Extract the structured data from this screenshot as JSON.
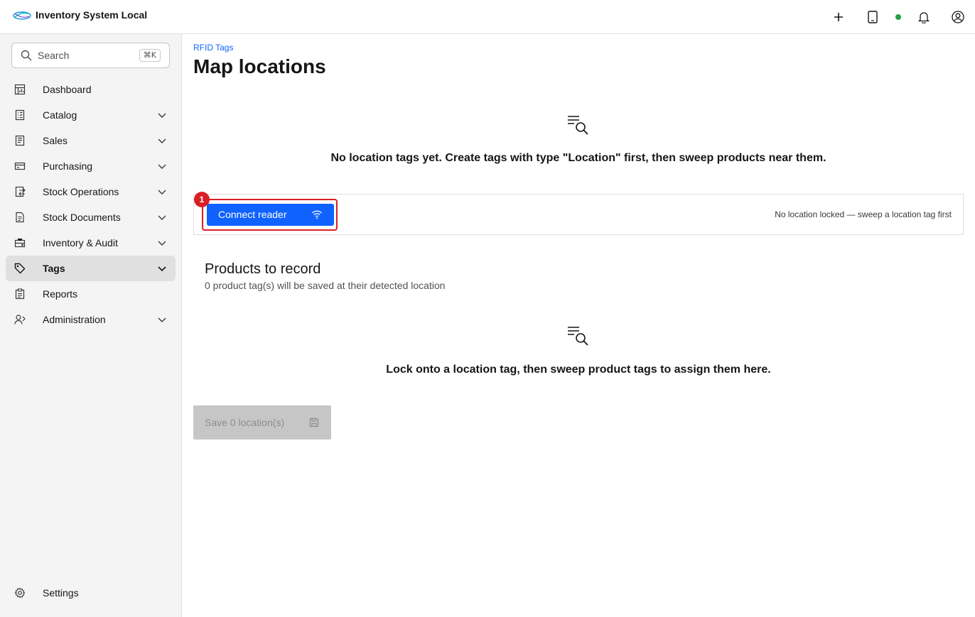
{
  "app": {
    "title": "Inventory System Local"
  },
  "topbar": {
    "icons": [
      "add-icon",
      "tablet-icon",
      "notification-icon",
      "user-avatar-icon"
    ],
    "status_color": "#24a148"
  },
  "sidebar": {
    "search": {
      "placeholder": "Search",
      "shortcut": "⌘K"
    },
    "items": [
      {
        "label": "Dashboard",
        "icon": "dashboard-icon",
        "expandable": false
      },
      {
        "label": "Catalog",
        "icon": "catalog-icon",
        "expandable": true
      },
      {
        "label": "Sales",
        "icon": "sales-icon",
        "expandable": true
      },
      {
        "label": "Purchasing",
        "icon": "purchasing-icon",
        "expandable": true
      },
      {
        "label": "Stock Operations",
        "icon": "stock-operations-icon",
        "expandable": true
      },
      {
        "label": "Stock Documents",
        "icon": "stock-documents-icon",
        "expandable": true
      },
      {
        "label": "Inventory & Audit",
        "icon": "inventory-audit-icon",
        "expandable": true
      },
      {
        "label": "Tags",
        "icon": "tag-icon",
        "expandable": true,
        "active": true
      },
      {
        "label": "Reports",
        "icon": "reports-icon",
        "expandable": false
      },
      {
        "label": "Administration",
        "icon": "administration-icon",
        "expandable": true
      }
    ],
    "settings": {
      "label": "Settings",
      "icon": "settings-icon"
    }
  },
  "main": {
    "breadcrumb": "RFID Tags",
    "title": "Map locations",
    "locations_empty": "No location tags yet. Create tags with type \"Location\" first, then sweep products near them.",
    "reader": {
      "connect_label": "Connect reader",
      "badge": "1",
      "status": "No location locked — sweep a location tag first"
    },
    "products": {
      "title": "Products to record",
      "subtitle": "0 product tag(s) will be saved at their detected location",
      "empty": "Lock onto a location tag, then sweep product tags to assign them here."
    },
    "save_label": "Save 0 location(s)"
  },
  "colors": {
    "accent": "#0f62fe",
    "highlight": "#da1e28",
    "disabled": "#c6c6c6"
  }
}
